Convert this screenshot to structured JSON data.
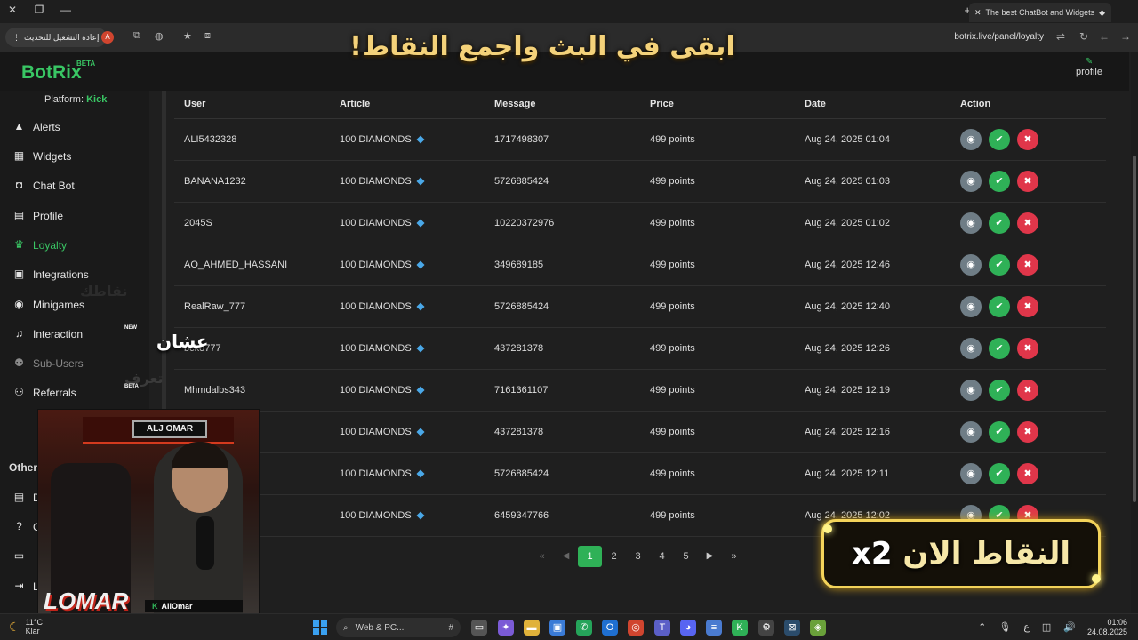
{
  "browser": {
    "tab_title": "The best ChatBot and Widgets",
    "restart_label": "إعادة التشغيل للتحديث",
    "profile_initial": "A",
    "url": "botrix.live/panel/loyalty"
  },
  "overlay": {
    "banner_text": "ابقى في البث واجمع النقاط!",
    "ashan_text": "عشان",
    "ta3raf_text": "تعرف",
    "nuqatak_text": "نقاطك",
    "x2_prefix": "النقاط الان",
    "x2_value": "x2"
  },
  "app": {
    "logo": "BotRix",
    "logo_beta": "BETA",
    "profile_label": "profile",
    "platform_label": "Platform:",
    "platform_value": "Kick"
  },
  "sidebar": {
    "items": [
      {
        "label": "Alerts",
        "icon": "warning-icon"
      },
      {
        "label": "Widgets",
        "icon": "widgets-icon"
      },
      {
        "label": "Chat Bot",
        "icon": "robot-icon"
      },
      {
        "label": "Profile",
        "icon": "id-card-icon"
      },
      {
        "label": "Loyalty",
        "icon": "trophy-icon"
      },
      {
        "label": "Integrations",
        "icon": "integrations-icon"
      },
      {
        "label": "Minigames",
        "icon": "gamepad-icon"
      },
      {
        "label": "Interaction",
        "icon": "music-icon",
        "badge": "NEW"
      },
      {
        "label": "Sub-Users",
        "icon": "users-icon"
      },
      {
        "label": "Referrals",
        "icon": "referrals-icon",
        "badge": "BETA"
      }
    ],
    "other_heading": "Other",
    "other_items": [
      "D",
      "C",
      "",
      "L"
    ]
  },
  "table": {
    "headers": [
      "User",
      "Article",
      "Message",
      "Price",
      "Date",
      "Action"
    ],
    "rows": [
      {
        "user": "ALI5432328",
        "article": "100 DIAMONDS",
        "message": "1717498307",
        "price": "499 points",
        "date": "Aug 24, 2025 01:04"
      },
      {
        "user": "BANANA1232",
        "article": "100 DIAMONDS",
        "message": "5726885424",
        "price": "499 points",
        "date": "Aug 24, 2025 01:03"
      },
      {
        "user": "2045S",
        "article": "100 DIAMONDS",
        "message": "10220372976",
        "price": "499 points",
        "date": "Aug 24, 2025 01:02"
      },
      {
        "user": "AO_AHMED_HASSANI",
        "article": "100 DIAMONDS",
        "message": "349689185",
        "price": "499 points",
        "date": "Aug 24, 2025 12:46"
      },
      {
        "user": "RealRaw_777",
        "article": "100 DIAMONDS",
        "message": "5726885424",
        "price": "499 points",
        "date": "Aug 24, 2025 12:40"
      },
      {
        "user": "bcko777",
        "article": "100 DIAMONDS",
        "message": "437281378",
        "price": "499 points",
        "date": "Aug 24, 2025 12:26"
      },
      {
        "user": "Mhmdalbs343",
        "article": "100 DIAMONDS",
        "message": "7161361107",
        "price": "499 points",
        "date": "Aug 24, 2025 12:19"
      },
      {
        "user": "",
        "article": "100 DIAMONDS",
        "message": "437281378",
        "price": "499 points",
        "date": "Aug 24, 2025 12:16"
      },
      {
        "user": "",
        "article": "100 DIAMONDS",
        "message": "5726885424",
        "price": "499 points",
        "date": "Aug 24, 2025 12:11"
      },
      {
        "user": "",
        "article": "100 DIAMONDS",
        "message": "6459347766",
        "price": "499 points",
        "date": "Aug 24, 2025 12:02"
      }
    ]
  },
  "pagination": {
    "pages": [
      "1",
      "2",
      "3",
      "4",
      "5"
    ],
    "current": "1"
  },
  "webcam": {
    "sign_text": "ALJ OMAR",
    "logo_text": "LOMAR",
    "name_prefix": "K",
    "name_text": "AliOmar"
  },
  "taskbar": {
    "temperature": "11°C",
    "weather": "Klar",
    "search_label": "Web & PC...",
    "time": "01:06",
    "date": "24.08.2025",
    "lang": "ع"
  },
  "colors": {
    "accent": "#39c664",
    "approve": "#2fb157",
    "reject": "#e0364a",
    "view": "#6f7d86"
  }
}
